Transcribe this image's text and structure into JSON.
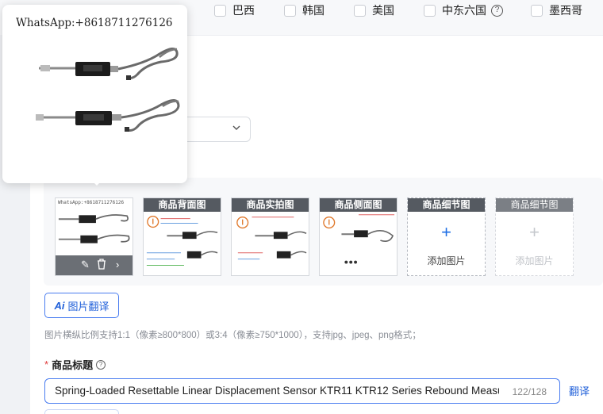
{
  "regions": {
    "items": [
      {
        "label": "巴西"
      },
      {
        "label": "韩国"
      },
      {
        "label": "美国"
      },
      {
        "label": "中东六国"
      },
      {
        "label": "墨西哥"
      }
    ]
  },
  "preview": {
    "watermark": "WhatsApp:+8618711276126"
  },
  "images": {
    "main_watermark": "WhatsApp:+8618711276126",
    "slots": [
      {
        "label": "商品背面图"
      },
      {
        "label": "商品实拍图"
      },
      {
        "label": "商品侧面图"
      },
      {
        "label": "商品细节图",
        "action": "添加图片"
      },
      {
        "label": "商品细节图",
        "action": "添加图片"
      }
    ],
    "main_actions": {
      "edit_icon": "pencil-icon",
      "delete_icon": "trash-icon",
      "next_icon": "chevron-right-icon"
    }
  },
  "ai_translate": {
    "badge": "Ai",
    "label": "图片翻译"
  },
  "hint": "图片横纵比例支持1:1（像素≥800*800）或3:4（像素≥750*1000），支持jpg、jpeg、png格式；",
  "product_title": {
    "label": "商品标题",
    "required_mark": "*",
    "value": "Spring-Loaded Resettable Linear Displacement Sensor KTR11 KTR12 Series Rebound Measu",
    "count": "122/128",
    "translate": "翻译"
  },
  "colors": {
    "accent": "#1f5fd9",
    "required": "#e03a3a"
  }
}
